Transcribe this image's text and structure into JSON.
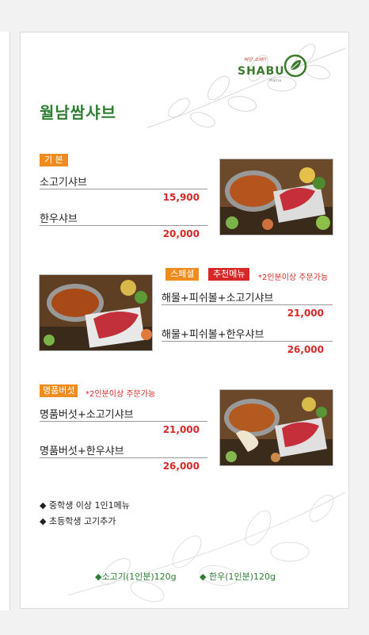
{
  "logo": {
    "tagline": "바당 소바!!",
    "name": "SHABU",
    "sub": "Mama"
  },
  "title": "월남쌈샤브",
  "sections": {
    "basic": {
      "tag": "기 본",
      "items": [
        {
          "name": "소고기샤브",
          "price": "15,900"
        },
        {
          "name": "한우샤브",
          "price": "20,000"
        }
      ]
    },
    "special": {
      "tag": "스페셜",
      "tag2": "추천메뉴",
      "note": "*2인분이상 주문가능",
      "items": [
        {
          "name": "해물+피쉬볼+소고기샤브",
          "price": "21,000"
        },
        {
          "name": "해물+피쉬볼+한우샤브",
          "price": "26,000"
        }
      ]
    },
    "mushroom": {
      "tag": "명품버섯",
      "note": "*2인분이상 주문가능",
      "items": [
        {
          "name": "명품버섯+소고기샤브",
          "price": "21,000"
        },
        {
          "name": "명품버섯+한우샤브",
          "price": "26,000"
        }
      ]
    }
  },
  "notes": [
    "◆ 중학생 이상 1인1메뉴",
    "◆ 초등학생 고기추가"
  ],
  "bottom": [
    "◆소고기(1인분)120g",
    "◆ 한우(1인분)120g"
  ]
}
